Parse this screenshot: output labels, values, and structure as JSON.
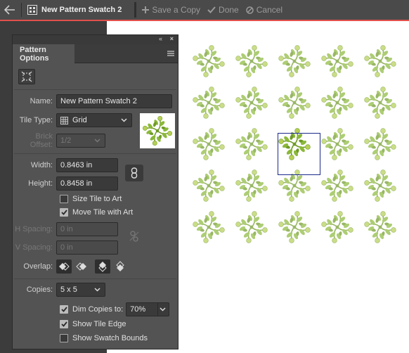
{
  "toolbar": {
    "title": "New Pattern Swatch 2",
    "save_copy": "Save a Copy",
    "done": "Done",
    "cancel": "Cancel"
  },
  "panel": {
    "tab": "Pattern Options",
    "name_label": "Name:",
    "name_value": "New Pattern Swatch 2",
    "tile_type_label": "Tile Type:",
    "tile_type_value": "Grid",
    "brick_offset_label": "Brick Offset:",
    "brick_offset_value": "1/2",
    "width_label": "Width:",
    "width_value": "0.8463 in",
    "height_label": "Height:",
    "height_value": "0.8458 in",
    "size_tile_label": "Size Tile to Art",
    "size_tile_checked": false,
    "move_tile_label": "Move Tile with Art",
    "move_tile_checked": true,
    "h_spacing_label": "H Spacing:",
    "h_spacing_value": "0 in",
    "v_spacing_label": "V Spacing:",
    "v_spacing_value": "0 in",
    "overlap_label": "Overlap:",
    "copies_label": "Copies:",
    "copies_value": "5 x 5",
    "dim_copies_label": "Dim Copies to:",
    "dim_copies_checked": true,
    "dim_copies_value": "70%",
    "show_tile_edge_label": "Show Tile Edge",
    "show_tile_edge_checked": true,
    "show_swatch_bounds_label": "Show Swatch Bounds",
    "show_swatch_bounds_checked": false
  },
  "pattern": {
    "rows": 5,
    "cols": 5,
    "center": [
      2,
      2
    ],
    "dim_opacity": 0.7
  },
  "colors": {
    "accent_red": "#e2514c",
    "leaf": "#8bb83a",
    "leaf_dark": "#6f9a26",
    "berry": "#b5cf55",
    "tile_edge": "#1c2a8a"
  },
  "icons": [
    "back-arrow-icon",
    "pattern-swatch-icon",
    "plus-icon",
    "checkmark-icon",
    "cancel-icon",
    "collapse-icon",
    "close-icon",
    "panel-menu-icon",
    "pattern-tile-tool-icon",
    "grid-icon",
    "chevron-down-icon",
    "link-icon",
    "unlink-icon"
  ]
}
